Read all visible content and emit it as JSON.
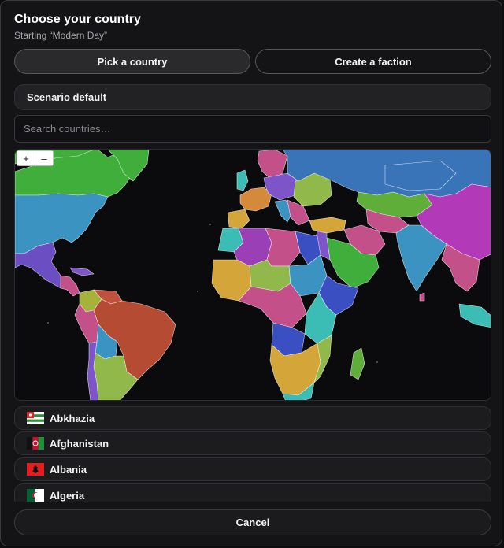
{
  "dialog": {
    "title": "Choose your country",
    "subtitle": "Starting “Modern Day”"
  },
  "tabs": [
    {
      "label": "Pick a country",
      "active": true
    },
    {
      "label": "Create a faction",
      "active": false
    }
  ],
  "scenario": {
    "label": "Scenario default"
  },
  "search": {
    "placeholder": "Search countries…",
    "value": ""
  },
  "map": {
    "zoom_in": "+",
    "zoom_out": "–",
    "ocean_color": "#0b0b0d",
    "border_color": "#ffffff"
  },
  "countries": [
    {
      "name": "Abkhazia",
      "flag": "abkhazia-flag-icon"
    },
    {
      "name": "Afghanistan",
      "flag": "afghanistan-flag-icon"
    },
    {
      "name": "Albania",
      "flag": "albania-flag-icon"
    },
    {
      "name": "Algeria",
      "flag": "algeria-flag-icon"
    }
  ],
  "footer": {
    "cancel_label": "Cancel"
  }
}
